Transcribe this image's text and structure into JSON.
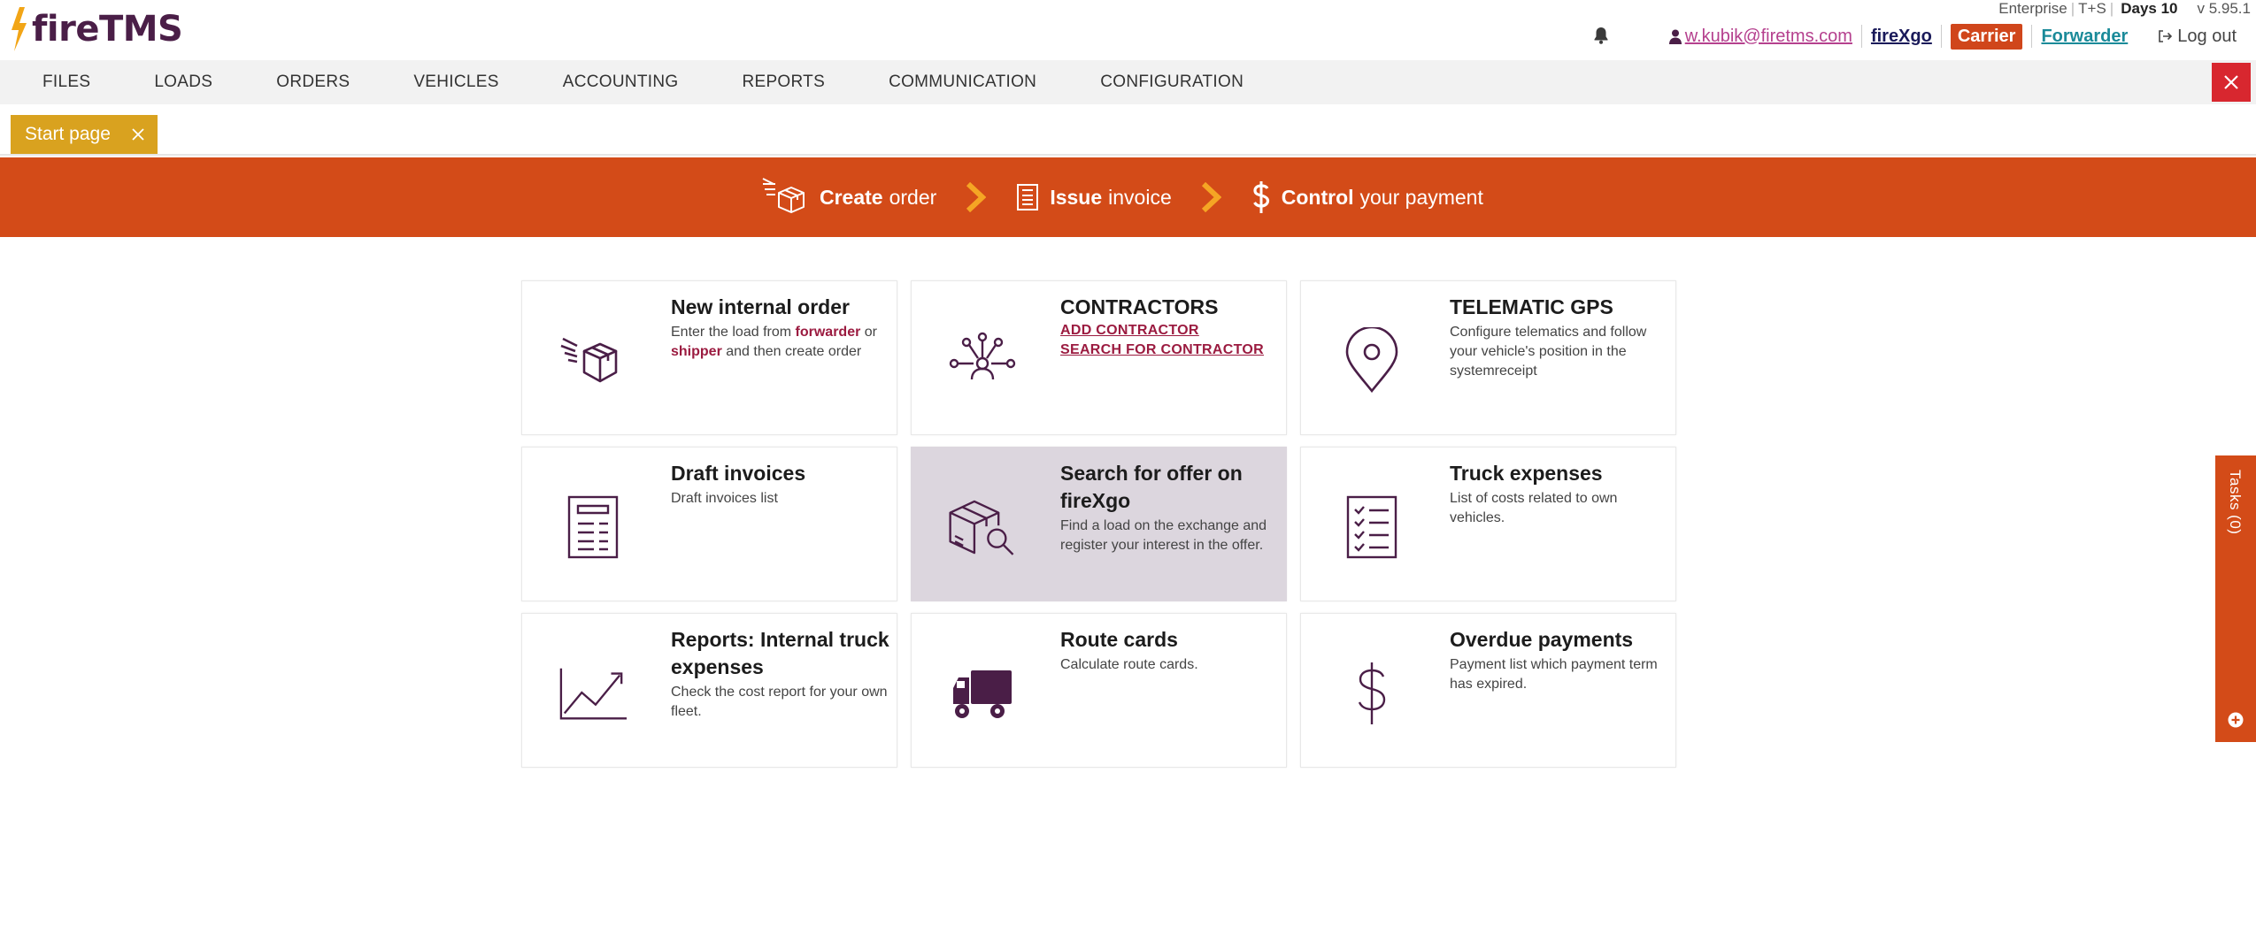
{
  "brand": {
    "name": "fireTMS",
    "name_color": "#4a1e47",
    "flame_color": "#f2a516"
  },
  "topinfo": {
    "plan": "Enterprise",
    "mode": "T+S",
    "days": "Days 10",
    "version": "v 5.95.1"
  },
  "userbar": {
    "email": "w.kubik@firetms.com",
    "firexgo": "fireXgo",
    "carrier": "Carrier",
    "forwarder": "Forwarder",
    "logout": "Log out"
  },
  "nav": {
    "items": [
      "FILES",
      "LOADS",
      "ORDERS",
      "VEHICLES",
      "ACCOUNTING",
      "REPORTS",
      "COMMUNICATION",
      "CONFIGURATION"
    ]
  },
  "tab": {
    "label": "Start page",
    "color": "#d9a21f"
  },
  "banner": {
    "color": "#d34b18",
    "steps": [
      {
        "bold": "Create",
        "rest": "order"
      },
      {
        "bold": "Issue",
        "rest": "invoice"
      },
      {
        "bold": "Control",
        "rest": "your payment"
      }
    ],
    "arrow_color": "#f5a524"
  },
  "tiles": {
    "new_order": {
      "title": "New internal order",
      "desc_prefix": "Enter the load from",
      "forwarder": "forwarder",
      "or": "or",
      "shipper": "shipper",
      "desc_suffix": "and then create order"
    },
    "contractors": {
      "title": "CONTRACTORS",
      "add": "ADD CONTRACTOR",
      "search": "SEARCH FOR CONTRACTOR"
    },
    "telematic": {
      "title": "TELEMATIC GPS",
      "desc": "Configure telematics and follow your vehicle's position in the systemreceipt"
    },
    "draft_invoices": {
      "title": "Draft invoices",
      "desc": "Draft invoices list"
    },
    "search_offer": {
      "title": "Search for offer on fireXgo",
      "desc": "Find a load on the exchange and register your interest in the offer."
    },
    "truck_expenses": {
      "title": "Truck expenses",
      "desc": "List of costs related to own vehicles."
    },
    "reports": {
      "title": "Reports: Internal truck expenses",
      "desc": "Check the cost report for your own fleet."
    },
    "route_cards": {
      "title": "Route cards",
      "desc": "Calculate route cards."
    },
    "overdue": {
      "title": "Overdue payments",
      "desc": "Payment list which payment term has expired."
    }
  },
  "tasks": {
    "label": "Tasks (0)"
  },
  "colors": {
    "icon": "#4a1e47",
    "accent_red": "#d8272f",
    "link": "#9b1b40"
  }
}
